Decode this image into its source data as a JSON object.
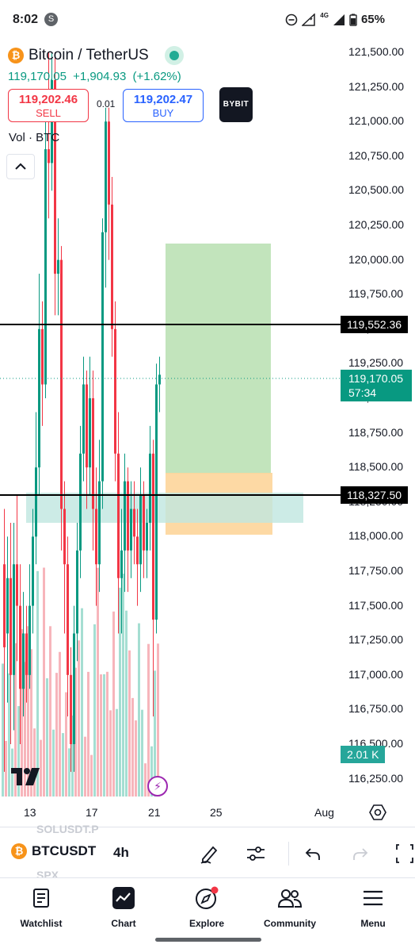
{
  "status_bar": {
    "time": "8:02",
    "notification_icon": "s-bubble-icon",
    "battery": "65%",
    "network": "4G"
  },
  "header": {
    "symbol_title": "Bitcoin / TetherUS",
    "price": "119,170.05",
    "change": "+1,904.93",
    "change_pct": "(+1.62%)",
    "sell_price": "119,202.46",
    "sell_label": "SELL",
    "spread": "0.01",
    "buy_price": "119,202.47",
    "buy_label": "BUY",
    "broker": "BYBIT"
  },
  "indicator": {
    "label": "Vol · BTC"
  },
  "y_axis": {
    "ticks": [
      "121,500.00",
      "121,250.00",
      "121,000.00",
      "120,750.00",
      "120,500.00",
      "120,250.00",
      "120,000.00",
      "119,750.00",
      "119,500.00",
      "119,250.00",
      "119,000.00",
      "118,750.00",
      "118,500.00",
      "118,250.00",
      "118,000.00",
      "117,750.00",
      "117,500.00",
      "117,250.00",
      "117,000.00",
      "116,750.00",
      "116,500.00",
      "116,250.00"
    ],
    "line_upper": "119,552.36",
    "line_lower": "118,327.50",
    "last_price": "119,170.05",
    "countdown": "57:34",
    "volume_value": "2.01 K"
  },
  "x_axis": {
    "ticks": [
      "13",
      "17",
      "21",
      "25",
      "Aug"
    ]
  },
  "colors": {
    "up": "#089981",
    "down": "#f23645",
    "buy": "#2962ff",
    "target_zone": "#b7dfb0",
    "stop_zone": "#fdd59a",
    "range_zone": "#bfe6e0"
  },
  "toolbar": {
    "ghost_top": "SOLUSDT.P",
    "ghost_bottom": "SPX",
    "symbol": "BTCUSDT",
    "interval": "4h"
  },
  "bottom_nav": {
    "watchlist": "Watchlist",
    "chart": "Chart",
    "explore": "Explore",
    "community": "Community",
    "menu": "Menu"
  }
}
